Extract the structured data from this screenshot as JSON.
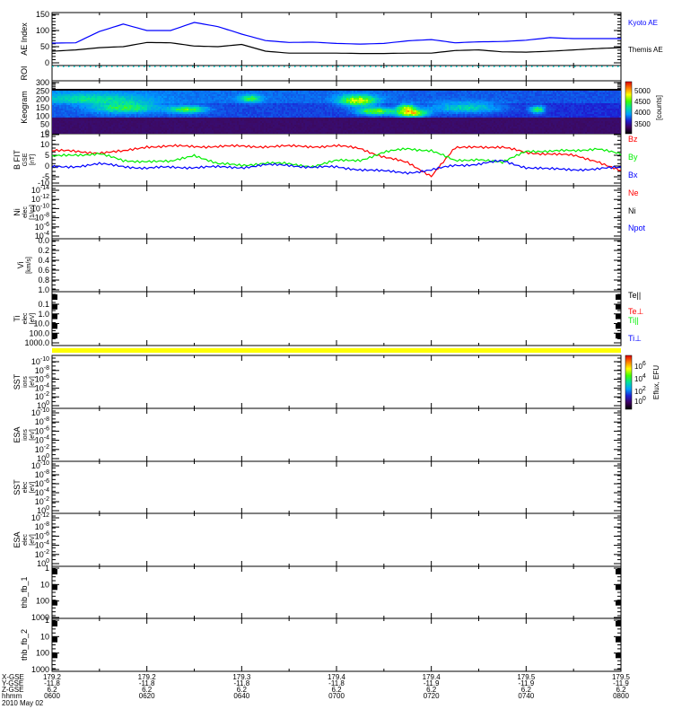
{
  "title": "P1  (TH-B)",
  "chart_data": {
    "type": "line",
    "x_unit": "minutes since 06:00 UT",
    "x": [
      0,
      5,
      10,
      15,
      20,
      25,
      30,
      35,
      40,
      45,
      50,
      55,
      60,
      65,
      70,
      75,
      80,
      85,
      90,
      95,
      100,
      105,
      110,
      115,
      120
    ],
    "xlim": [
      0,
      120
    ],
    "time_ticks": [
      "0600",
      "0620",
      "0640",
      "0700",
      "0720",
      "0740",
      "0800"
    ],
    "ephemeris": {
      "row_labels": [
        "X-GSE",
        "Y-GSE",
        "Z-GSE",
        "hhmm"
      ],
      "x_gse": [
        "179.2",
        "179.2",
        "179.3",
        "179.4",
        "179.4",
        "179.5",
        "179.5"
      ],
      "y_gse": [
        "-11.8",
        "-11.8",
        "-11.8",
        "-11.8",
        "-11.9",
        "-11.9",
        "-11.9"
      ],
      "z_gse": [
        "6.2",
        "6.2",
        "6.2",
        "6.2",
        "6.2",
        "6.2",
        "6.2"
      ],
      "date": "2010 May 02"
    },
    "panels": [
      {
        "id": "ae",
        "ylabel": [
          "AE Index"
        ],
        "ylim": [
          -6,
          156
        ],
        "yticks": [
          "0",
          "50",
          "100",
          "150"
        ],
        "ytick_values": [
          0,
          50,
          100,
          150
        ],
        "series": [
          {
            "name": "Kyoto AE",
            "color": "#0000ff",
            "values": [
              61,
              62,
              97,
              120,
              100,
              100,
              125,
              112,
              89,
              69,
              63,
              64,
              60,
              58,
              60,
              68,
              72,
              62,
              65,
              66,
              70,
              78,
              75,
              75,
              75
            ]
          },
          {
            "name": "Themis AE",
            "color": "#000000",
            "values": [
              36,
              40,
              47,
              50,
              63,
              62,
              52,
              50,
              57,
              36,
              30,
              30,
              30,
              29,
              29,
              30,
              30,
              38,
              40,
              34,
              33,
              36,
              40,
              44,
              47
            ]
          }
        ]
      },
      {
        "id": "roi",
        "ylabel": [
          "ROI"
        ],
        "yticks": [],
        "dotted_color": "#00e0e0"
      },
      {
        "id": "keogram",
        "ylabel": [
          "Keogram"
        ],
        "ylim": [
          0,
          300
        ],
        "yticks": [
          "0",
          "50",
          "100",
          "150",
          "200",
          "250",
          "300"
        ],
        "ytick_values": [
          0,
          50,
          100,
          150,
          200,
          250,
          300
        ],
        "colorbar": {
          "label": "[counts]",
          "ticks": [
            "5000",
            "4500",
            "4000",
            "3500"
          ]
        }
      },
      {
        "id": "bfit",
        "ylabel": [
          "B FIT",
          "GSE",
          "[nT]"
        ],
        "ylim": [
          -10,
          15
        ],
        "yticks": [
          "15",
          "10",
          "5",
          "0",
          "-5",
          "-10"
        ],
        "series": [
          {
            "name": "Bz",
            "color": "#ff0000",
            "values": [
              7,
              6.5,
              6,
              6.5,
              9,
              9,
              9,
              9,
              9,
              9,
              9,
              9,
              9.2,
              8,
              4,
              1,
              -5,
              8,
              9,
              8.5,
              6,
              5.5,
              4.5,
              2,
              -3
            ]
          },
          {
            "name": "By",
            "color": "#00ee00",
            "values": [
              4,
              5,
              5.5,
              2,
              2,
              1.5,
              5,
              0.5,
              0,
              1,
              0.5,
              -0.5,
              2,
              2.5,
              6,
              8,
              7,
              2,
              3,
              1,
              7,
              6.5,
              7,
              8,
              5
            ]
          },
          {
            "name": "Bx",
            "color": "#0000ff",
            "values": [
              -1,
              -0.5,
              0.5,
              -0.5,
              -1.5,
              -1,
              -1,
              -1,
              -1,
              0,
              0,
              -1,
              -1,
              -2,
              -3,
              -3.5,
              -2.5,
              0,
              0.5,
              2,
              -1,
              -2,
              -2,
              -2,
              -1
            ]
          }
        ]
      },
      {
        "id": "ni",
        "ylabel": [
          "Ni",
          "elec",
          "[1/cc]"
        ],
        "yticks": [
          "10^-4",
          "10^-6",
          "10^-8",
          "10^-10",
          "10^-12",
          "10^-14"
        ],
        "legend": [
          {
            "name": "Ne",
            "color": "#ff0000"
          },
          {
            "name": "Ni",
            "color": "#000000"
          },
          {
            "name": "Npot",
            "color": "#0000ff"
          }
        ]
      },
      {
        "id": "vi",
        "ylabel": [
          "Vi",
          "[km/s]"
        ],
        "yticks": [
          "1.0",
          "0.8",
          "0.6",
          "0.4",
          "0.2",
          "0.0"
        ]
      },
      {
        "id": "ti",
        "ylabel": [
          "Ti",
          "elec",
          "[eV]"
        ],
        "yticks": [
          "1000.0",
          "100.0",
          "10.0",
          "1.0",
          "0.1"
        ],
        "legend": [
          {
            "name": "Te||",
            "color": "#000000"
          },
          {
            "name": "Te⊥",
            "color": "#ff0000"
          },
          {
            "name": "Ti||",
            "color": "#00ee00"
          },
          {
            "name": "Ti⊥",
            "color": "#0000ff"
          }
        ]
      },
      {
        "id": "sst_i",
        "ylabel": [
          "SST",
          "ions",
          "[eV]"
        ],
        "yticks": [
          "10^0",
          "10^-2",
          "10^-4",
          "10^-6",
          "10^-8",
          "10^-10"
        ],
        "colorbar": {
          "label": "Eflux, EFU",
          "ticks": [
            "10^6",
            "10^4",
            "10^2",
            "10^0"
          ]
        }
      },
      {
        "id": "esa_i",
        "ylabel": [
          "ESA",
          "ions",
          "[eV]"
        ],
        "yticks": [
          "10^0",
          "10^-2",
          "10^-4",
          "10^-6",
          "10^-8",
          "10^-10"
        ]
      },
      {
        "id": "sst_e",
        "ylabel": [
          "SST",
          "elec",
          "[eV]"
        ],
        "yticks": [
          "10^0",
          "10^-2",
          "10^-4",
          "10^-6",
          "10^-8",
          "10^-10"
        ]
      },
      {
        "id": "esa_e",
        "ylabel": [
          "ESA",
          "elec",
          "[eV]"
        ],
        "yticks": [
          "10^0",
          "10^-2",
          "10^-4",
          "10^-6",
          "10^-8",
          "10^-12"
        ]
      },
      {
        "id": "fb1",
        "ylabel": [
          "thb_fb_1"
        ],
        "yticks": [
          "1000",
          "100",
          "10",
          "1"
        ]
      },
      {
        "id": "fb2",
        "ylabel": [
          "thb_fb_2"
        ],
        "yticks": [
          "1000",
          "100",
          "10",
          "1"
        ]
      }
    ]
  }
}
